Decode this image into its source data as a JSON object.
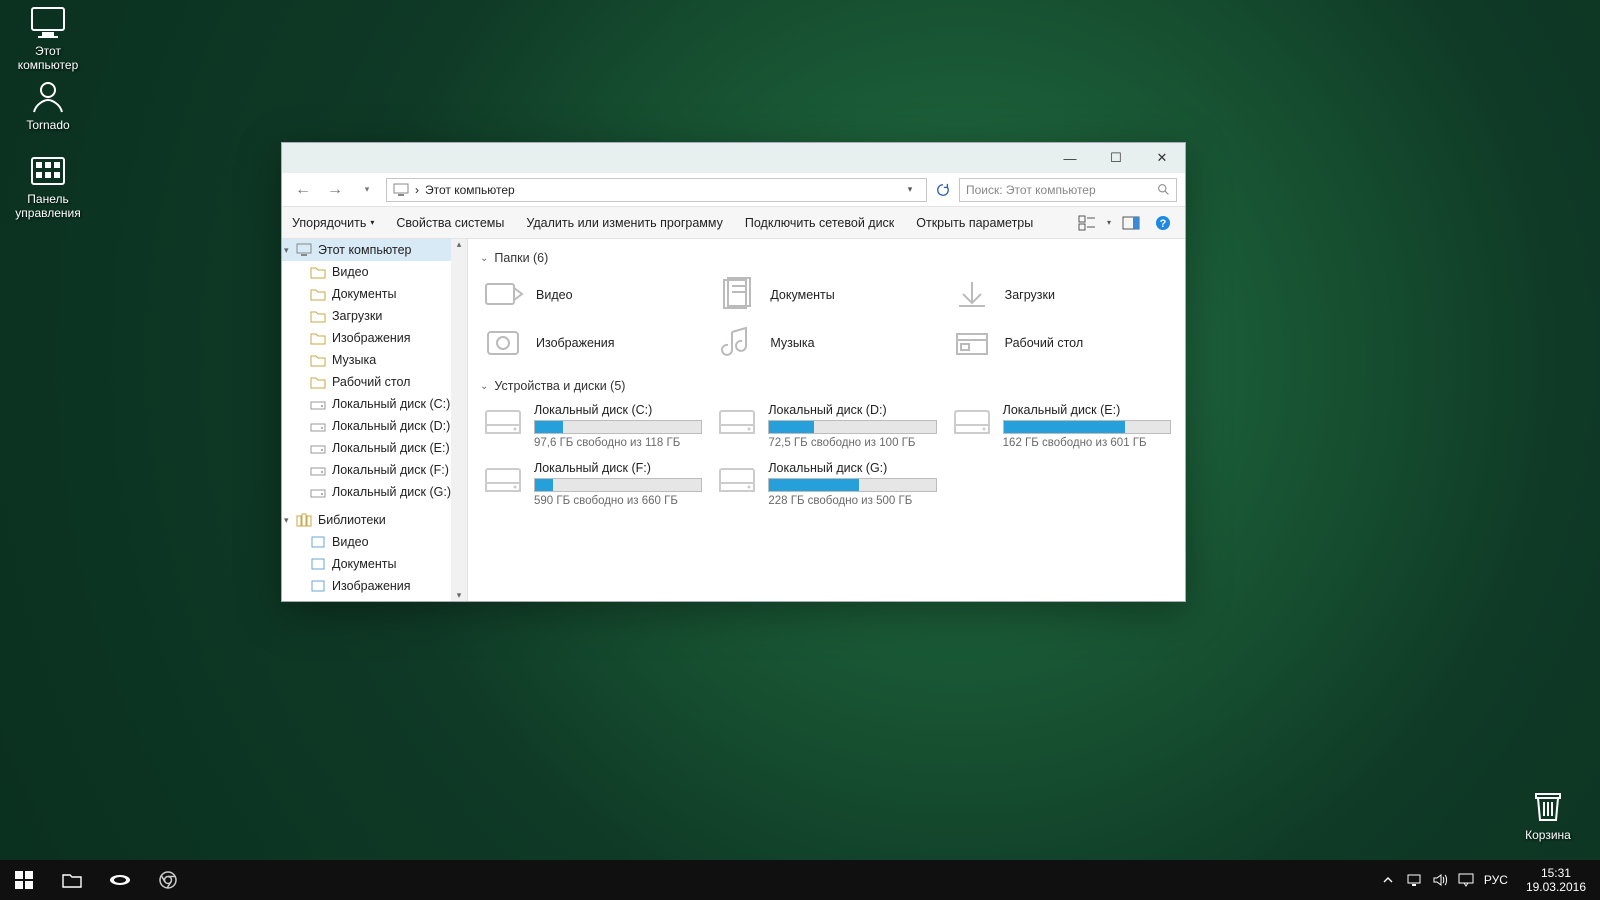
{
  "desktop": {
    "icons": [
      {
        "name": "this-pc",
        "label": "Этот\nкомпьютер"
      },
      {
        "name": "tornado",
        "label": "Tornado"
      },
      {
        "name": "control-panel",
        "label": "Панель\nуправления"
      }
    ],
    "recycle_bin": "Корзина"
  },
  "taskbar": {
    "lang": "РУС",
    "time": "15:31",
    "date": "19.03.2016"
  },
  "explorer": {
    "address_prefix": "›",
    "address_label": "Этот компьютер",
    "search_placeholder": "Поиск: Этот компьютер",
    "toolbar": {
      "organize": "Упорядочить",
      "system_props": "Свойства системы",
      "uninstall": "Удалить или изменить программу",
      "map_drive": "Подключить сетевой диск",
      "open_settings": "Открыть параметры"
    },
    "sidebar": {
      "this_pc": "Этот компьютер",
      "children": [
        "Видео",
        "Документы",
        "Загрузки",
        "Изображения",
        "Музыка",
        "Рабочий стол",
        "Локальный диск (C:)",
        "Локальный диск (D:)",
        "Локальный диск (E:)",
        "Локальный диск (F:)",
        "Локальный диск (G:)"
      ],
      "libraries": "Библиотеки",
      "lib_children": [
        "Видео",
        "Документы",
        "Изображения"
      ]
    },
    "content": {
      "folders_header": "Папки (6)",
      "drives_header": "Устройства и диски (5)",
      "folders": [
        "Видео",
        "Документы",
        "Загрузки",
        "Изображения",
        "Музыка",
        "Рабочий стол"
      ],
      "drives": [
        {
          "name": "Локальный диск (C:)",
          "free": "97,6 ГБ свободно из 118 ГБ",
          "used_pct": 17
        },
        {
          "name": "Локальный диск (D:)",
          "free": "72,5 ГБ свободно из 100 ГБ",
          "used_pct": 27
        },
        {
          "name": "Локальный диск (E:)",
          "free": "162 ГБ свободно из 601 ГБ",
          "used_pct": 73
        },
        {
          "name": "Локальный диск (F:)",
          "free": "590 ГБ свободно из 660 ГБ",
          "used_pct": 11
        },
        {
          "name": "Локальный диск (G:)",
          "free": "228 ГБ свободно из 500 ГБ",
          "used_pct": 54
        }
      ]
    }
  }
}
